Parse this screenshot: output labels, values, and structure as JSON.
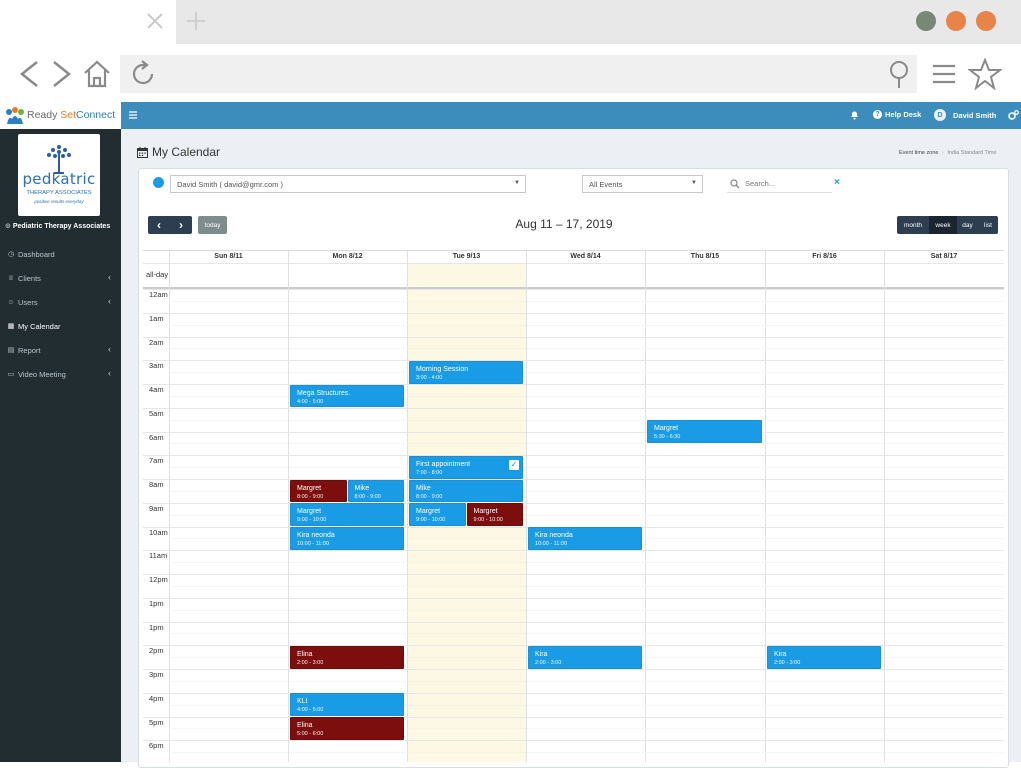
{
  "browser": {
    "close_icon": "close-icon",
    "new_tab_icon": "plus-icon",
    "nav_icons": [
      "back-icon",
      "forward-icon",
      "home-icon",
      "reload-icon"
    ],
    "right_icons": [
      "location-pin-icon",
      "menu-icon",
      "star-icon"
    ],
    "window_dot_colors": [
      "#778877",
      "#e8834a",
      "#e8834a"
    ]
  },
  "app": {
    "logo_text_a": "Ready ",
    "logo_text_b": "Set",
    "logo_text_c": "Connect",
    "menu_icon": "hamburger-icon",
    "bell_icon": "bell-icon",
    "help_label": "Help Desk",
    "user_initial": "D",
    "user_name": "David Smith",
    "settings_icon": "gears-icon",
    "brand_color": "#3c8dbc",
    "sidebar_color": "#222d32"
  },
  "sidebar": {
    "org_logo_line1": "pedkatric",
    "org_logo_line2": "THERAPY ASSOCIATES",
    "org_logo_line3": "positive results everyday",
    "org_name": "Pediatric Therapy Associates",
    "items": [
      {
        "label": "Dashboard",
        "icon": "dashboard-icon",
        "chevron": ""
      },
      {
        "label": "Clients",
        "icon": "trophy-icon",
        "chevron": "‹"
      },
      {
        "label": "Users",
        "icon": "users-icon",
        "chevron": "‹"
      },
      {
        "label": "My Calendar",
        "icon": "calendar-icon",
        "chevron": ""
      },
      {
        "label": "Report",
        "icon": "report-icon",
        "chevron": "‹"
      },
      {
        "label": "Video Meeting",
        "icon": "video-icon",
        "chevron": "‹"
      }
    ]
  },
  "page": {
    "title": "My Calendar",
    "tz_label": "Event time zone",
    "tz_sep": "›",
    "tz_value": "India Standard Time"
  },
  "filters": {
    "user_select": "David Smith ( david@gmr.com )",
    "events_select": "All Events",
    "search_placeholder": "Search...",
    "clear_icon": "×"
  },
  "calendar": {
    "prev": "‹",
    "next": "›",
    "today": "today",
    "range_title": "Aug 11 – 17, 2019",
    "views": [
      "month",
      "week",
      "day",
      "list"
    ],
    "allday_label": "all-day",
    "days": [
      "Sun 8/11",
      "Mon 8/12",
      "Tue 9/13",
      "Wed 8/14",
      "Thu 8/15",
      "Fri 8/16",
      "Sat 8/17"
    ],
    "hours": [
      "12am",
      "1am",
      "2am",
      "3am",
      "4am",
      "5am",
      "6am",
      "7am",
      "8am",
      "9am",
      "10am",
      "11am",
      "12pm",
      "1pm",
      "1pm",
      "2pm",
      "3pm",
      "4pm",
      "5pm",
      "6pm"
    ],
    "events": [
      {
        "title": "Morning Session",
        "time": "3:00 - 4:00",
        "color": "blue",
        "checked": false
      },
      {
        "title": "Mega Structures.",
        "time": "4:00 - 5:00",
        "color": "blue",
        "checked": false
      },
      {
        "title": "Margret",
        "time": "5:30 - 6:30",
        "color": "blue",
        "checked": false
      },
      {
        "title": "First appointment",
        "time": "7:00 - 8:00",
        "color": "blue",
        "checked": true
      },
      {
        "title": "Margret",
        "time": "8:00 - 9:00",
        "color": "red",
        "checked": false
      },
      {
        "title": "Mike",
        "time": "8:00 - 9:00",
        "color": "blue",
        "checked": false
      },
      {
        "title": "Mike",
        "time": "8:00 - 9:00",
        "color": "blue",
        "checked": false
      },
      {
        "title": "Margret",
        "time": "9:00 - 10:00",
        "color": "blue",
        "checked": false
      },
      {
        "title": "Margret",
        "time": "9:00 - 10:00",
        "color": "blue",
        "checked": false
      },
      {
        "title": "Margret",
        "time": "9:00 - 10:00",
        "color": "red",
        "checked": false
      },
      {
        "title": "Kira neonda",
        "time": "10:00 - 11:00",
        "color": "blue",
        "checked": false
      },
      {
        "title": "Kira neonda",
        "time": "10:00 - 11:00",
        "color": "blue",
        "checked": false
      },
      {
        "title": "Elina",
        "time": "2:00 - 3:00",
        "color": "red",
        "checked": false
      },
      {
        "title": "Kira",
        "time": "2:00 - 3:00",
        "color": "blue",
        "checked": false
      },
      {
        "title": "Kira",
        "time": "2:00 - 3:00",
        "color": "blue",
        "checked": false
      },
      {
        "title": "KLI",
        "time": "4:00 - 5:00",
        "color": "blue",
        "checked": false
      },
      {
        "title": "Elina",
        "time": "5:00 - 6:00",
        "color": "red",
        "checked": false
      }
    ],
    "event_colors": {
      "blue": "#1a9be6",
      "red": "#7d0e0e"
    },
    "today_column_color": "#fcf8e3"
  }
}
